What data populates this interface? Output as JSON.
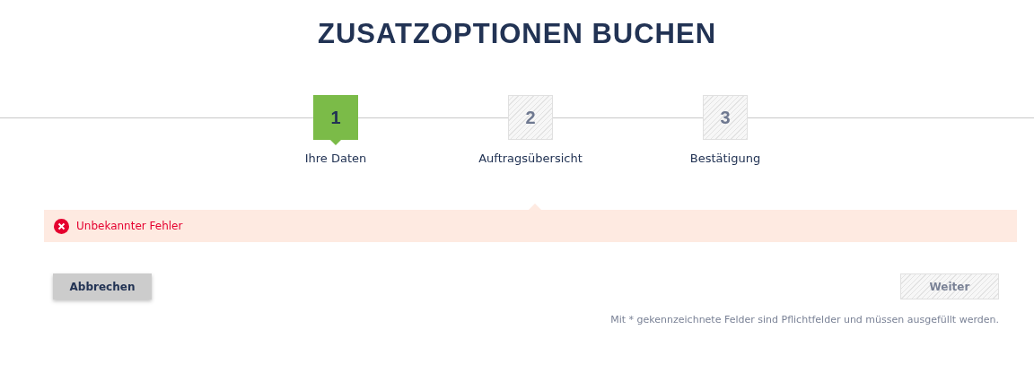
{
  "title": "ZUSATZOPTIONEN BUCHEN",
  "steps": [
    {
      "number": "1",
      "label": "Ihre Daten",
      "selected": true
    },
    {
      "number": "2",
      "label": "Auftragsübersicht",
      "selected": false
    },
    {
      "number": "3",
      "label": "Bestätigung",
      "selected": false
    }
  ],
  "alert": {
    "kind": "error",
    "message": "Unbekannter Fehler"
  },
  "buttons": [
    {
      "label": "Abbrechen",
      "disabled": false
    },
    {
      "label": "Weiter",
      "disabled": true
    }
  ],
  "footnote": "Mit * gekennzeichnete Felder sind Pflichtfelder und müssen ausgefüllt werden."
}
